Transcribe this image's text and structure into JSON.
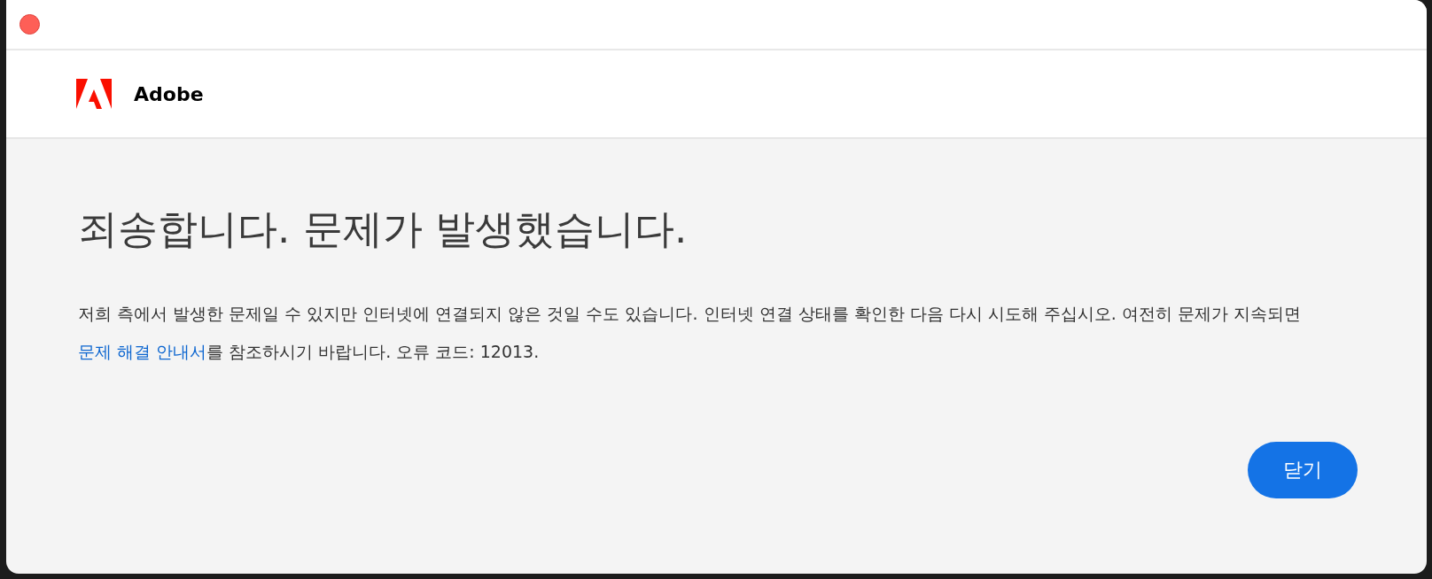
{
  "header": {
    "brand": "Adobe"
  },
  "dialog": {
    "title": "죄송합니다. 문제가 발생했습니다.",
    "message_before": "저희 측에서 발생한 문제일 수 있지만 인터넷에 연결되지 않은 것일 수도 있습니다. 인터넷 연결 상태를 확인한 다음 다시 시도해 주십시오. 여전히 문제가 지속되면 ",
    "message_link": "문제 해결 안내서",
    "message_after": "를 참조하시기 바랍니다. 오류 코드: 12013."
  },
  "buttons": [
    "닫기"
  ]
}
